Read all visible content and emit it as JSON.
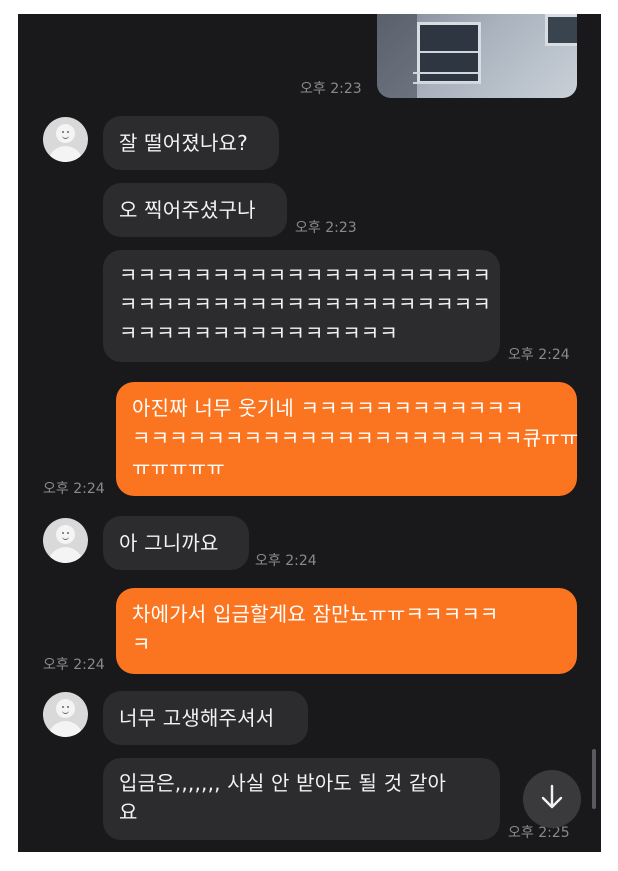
{
  "chat": {
    "photo_time": "오후 2:23",
    "messages": [
      {
        "side": "in",
        "avatar": "default-avatar",
        "lines": [
          "잘 떨어졌나요?"
        ],
        "time": ""
      },
      {
        "side": "in",
        "avatar": "",
        "lines": [
          "오 찍어주셨구나"
        ],
        "time": "오후 2:23"
      },
      {
        "side": "in",
        "avatar": "",
        "lines": [
          "ㅋㅋㅋㅋㅋㅋㅋㅋㅋㅋㅋㅋㅋㅋㅋㅋㅋㅋㅋㅋ",
          "ㅋㅋㅋㅋㅋㅋㅋㅋㅋㅋㅋㅋㅋㅋㅋㅋㅋㅋㅋㅋ",
          "ㅋㅋㅋㅋㅋㅋㅋㅋㅋㅋㅋㅋㅋㅋㅋ"
        ],
        "time": "오후 2:24"
      },
      {
        "side": "out",
        "lines": [
          "아진짜 너무 웃기네 ㅋㅋㅋㅋㅋㅋㅋㅋㅋㅋㅋㅋ",
          "ㅋㅋㅋㅋㅋㅋㅋㅋㅋㅋㅋㅋㅋㅋㅋㅋㅋㅋㅋㅋㅋ큐ㅠㅠ",
          "ㅠㅠㅠㅠㅠ"
        ],
        "time": "오후 2:24"
      },
      {
        "side": "in",
        "avatar": "default-avatar",
        "lines": [
          "아 그니까요"
        ],
        "time": "오후 2:24"
      },
      {
        "side": "out",
        "lines": [
          "차에가서 입금할게요 잠만뇨ㅠㅠㅋㅋㅋㅋㅋ",
          "ㅋ"
        ],
        "time": "오후 2:24"
      },
      {
        "side": "in",
        "avatar": "default-avatar",
        "lines": [
          "너무 고생해주셔서"
        ],
        "time": ""
      },
      {
        "side": "in",
        "avatar": "",
        "lines": [
          "입금은,,,,,,, 사실 안 받아도 될 것 같아",
          "요"
        ],
        "time": "오후 2:25"
      }
    ]
  },
  "icons": {
    "scroll_down": "arrow-down-icon",
    "avatar": "default-avatar"
  },
  "colors": {
    "background": "#19191b",
    "incoming": "#2c2c2e",
    "outgoing": "#fb7520",
    "timestamp": "#8a8a8e"
  }
}
